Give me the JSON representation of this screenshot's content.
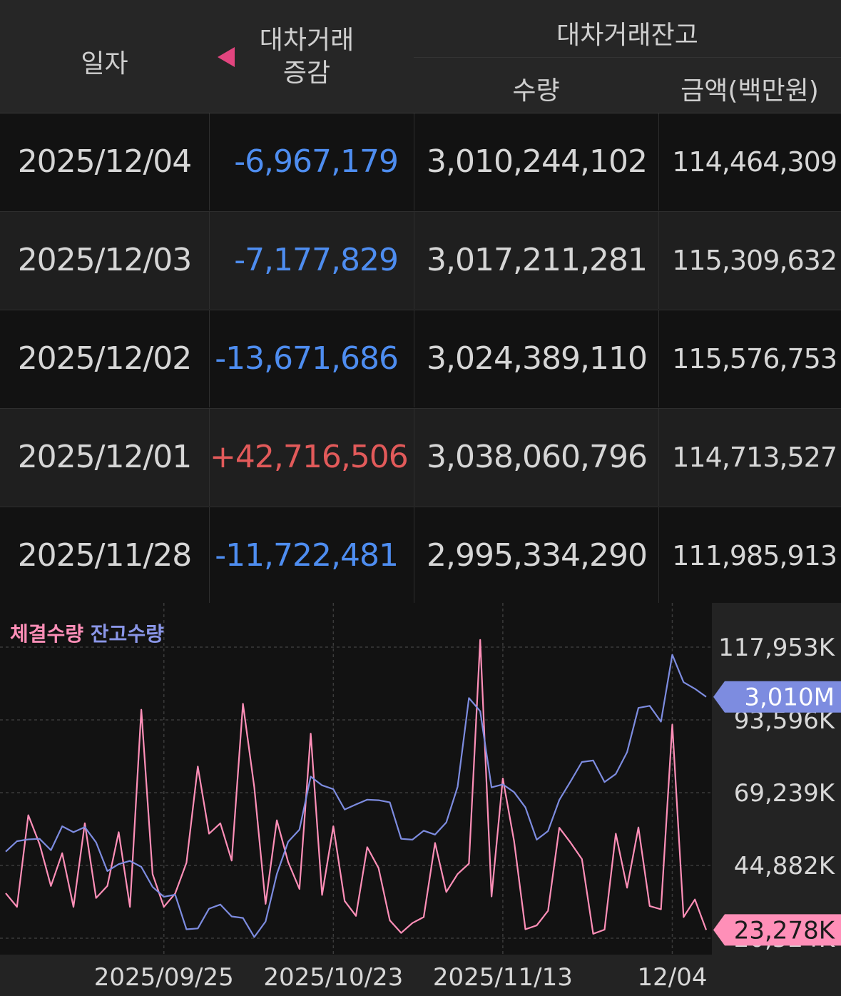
{
  "table": {
    "headers": {
      "date": "일자",
      "change_line1": "대차거래",
      "change_line2": "증감",
      "balance": "대차거래잔고",
      "qty": "수량",
      "amount": "금액(백만원)"
    },
    "rows": [
      {
        "date": "2025/12/04",
        "change": "-6,967,179",
        "direction": "down",
        "qty": "3,010,244,102",
        "amount": "114,464,309"
      },
      {
        "date": "2025/12/03",
        "change": "-7,177,829",
        "direction": "down",
        "qty": "3,017,211,281",
        "amount": "115,309,632"
      },
      {
        "date": "2025/12/02",
        "change": "-13,671,686",
        "direction": "down",
        "qty": "3,024,389,110",
        "amount": "115,576,753"
      },
      {
        "date": "2025/12/01",
        "change": "+42,716,506",
        "direction": "up",
        "qty": "3,038,060,796",
        "amount": "114,713,527"
      },
      {
        "date": "2025/11/28",
        "change": "-11,722,481",
        "direction": "down",
        "qty": "2,995,334,290",
        "amount": "111,985,913"
      }
    ]
  },
  "chart_data": {
    "type": "line",
    "legend": {
      "executed": "체결수량",
      "balance": "잔고수량"
    },
    "colors": {
      "executed": "#ff8fb8",
      "balance": "#7d8ce0",
      "negative": "#4e8df0",
      "positive": "#e25a5a",
      "sort_icon": "#e2457f"
    },
    "y_ticks": [
      "117,953K",
      "93,596K",
      "69,239K",
      "44,882K",
      "20,524K"
    ],
    "y_tick_values": [
      117953,
      93596,
      69239,
      44882,
      20524
    ],
    "ylim": [
      20524,
      117953
    ],
    "x_ticks": [
      "2025/09/25",
      "2025/10/23",
      "2025/11/13",
      "12/04"
    ],
    "x_tick_indices": [
      14,
      29,
      44,
      59
    ],
    "current_balance_label": "3,010M",
    "current_executed_label": "23,278K",
    "series": [
      {
        "name": "체결수량",
        "key": "executed",
        "values": [
          35600,
          31000,
          61700,
          52000,
          38000,
          49000,
          31000,
          59000,
          34000,
          38000,
          56000,
          31000,
          97000,
          42000,
          31000,
          35500,
          45800,
          78000,
          55500,
          59000,
          46500,
          99000,
          71000,
          32000,
          60000,
          46000,
          37000,
          89000,
          35000,
          58000,
          33000,
          28000,
          51000,
          44000,
          26500,
          22300,
          25600,
          27600,
          52400,
          36000,
          42000,
          45500,
          120400,
          34500,
          74000,
          53000,
          23500,
          24800,
          29700,
          57500,
          52500,
          47000,
          22000,
          23400,
          55500,
          37400,
          57600,
          31300,
          30200,
          92000,
          27600,
          33500,
          23300
        ]
      },
      {
        "name": "잔고수량",
        "key": "balance",
        "values": [
          49500,
          53000,
          53600,
          53800,
          50000,
          58000,
          56000,
          57700,
          52600,
          43000,
          45300,
          46400,
          44400,
          37700,
          34400,
          35100,
          23500,
          23800,
          30400,
          31800,
          27800,
          27300,
          20900,
          26100,
          42000,
          52800,
          56900,
          74600,
          71700,
          70400,
          63600,
          65300,
          66900,
          66700,
          66000,
          53800,
          53500,
          56500,
          55200,
          59300,
          71200,
          100900,
          96500,
          71000,
          72000,
          69400,
          64300,
          53500,
          56400,
          66800,
          73000,
          79500,
          80000,
          72800,
          75500,
          82800,
          97600,
          98300,
          93000,
          115400,
          106200,
          104000,
          101300
        ]
      }
    ]
  }
}
